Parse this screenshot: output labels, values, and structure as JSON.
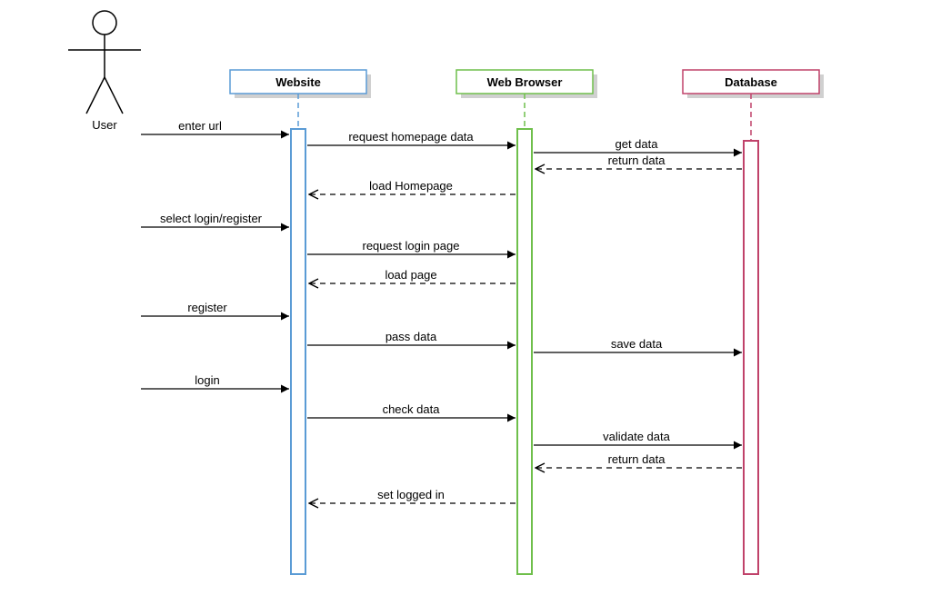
{
  "actor": {
    "name": "User"
  },
  "participants": [
    {
      "id": "website",
      "label": "Website",
      "color": "#5A9BD5"
    },
    {
      "id": "browser",
      "label": "Web Browser",
      "color": "#6FBF4B"
    },
    {
      "id": "database",
      "label": "Database",
      "color": "#C0426A"
    }
  ],
  "messages": [
    {
      "id": "m1",
      "from": "user",
      "to": "website",
      "text": "enter url",
      "style": "solid"
    },
    {
      "id": "m2",
      "from": "website",
      "to": "browser",
      "text": "request homepage data",
      "style": "solid"
    },
    {
      "id": "m3",
      "from": "browser",
      "to": "database",
      "text": "get data",
      "style": "solid"
    },
    {
      "id": "m4",
      "from": "database",
      "to": "browser",
      "text": "return data",
      "style": "dashed"
    },
    {
      "id": "m5",
      "from": "browser",
      "to": "website",
      "text": "load Homepage",
      "style": "dashed"
    },
    {
      "id": "m6",
      "from": "user",
      "to": "website",
      "text": "select login/register",
      "style": "solid"
    },
    {
      "id": "m7",
      "from": "website",
      "to": "browser",
      "text": "request login page",
      "style": "solid"
    },
    {
      "id": "m8",
      "from": "browser",
      "to": "website",
      "text": "load page",
      "style": "dashed"
    },
    {
      "id": "m9",
      "from": "user",
      "to": "website",
      "text": "register",
      "style": "solid"
    },
    {
      "id": "m10",
      "from": "website",
      "to": "browser",
      "text": "pass data",
      "style": "solid"
    },
    {
      "id": "m11",
      "from": "browser",
      "to": "database",
      "text": "save data",
      "style": "solid"
    },
    {
      "id": "m12",
      "from": "user",
      "to": "website",
      "text": "login",
      "style": "solid"
    },
    {
      "id": "m13",
      "from": "website",
      "to": "browser",
      "text": "check data",
      "style": "solid"
    },
    {
      "id": "m14",
      "from": "browser",
      "to": "database",
      "text": "validate data",
      "style": "solid"
    },
    {
      "id": "m15",
      "from": "database",
      "to": "browser",
      "text": "return data",
      "style": "dashed"
    },
    {
      "id": "m16",
      "from": "browser",
      "to": "website",
      "text": "set logged in",
      "style": "dashed"
    }
  ],
  "chart_data": {
    "type": "sequence-diagram",
    "title": "",
    "actor": "User",
    "participants": [
      "Website",
      "Web Browser",
      "Database"
    ],
    "messages": [
      {
        "from": "User",
        "to": "Website",
        "label": "enter url",
        "return": false
      },
      {
        "from": "Website",
        "to": "Web Browser",
        "label": "request homepage data",
        "return": false
      },
      {
        "from": "Web Browser",
        "to": "Database",
        "label": "get data",
        "return": false
      },
      {
        "from": "Database",
        "to": "Web Browser",
        "label": "return data",
        "return": true
      },
      {
        "from": "Web Browser",
        "to": "Website",
        "label": "load Homepage",
        "return": true
      },
      {
        "from": "User",
        "to": "Website",
        "label": "select login/register",
        "return": false
      },
      {
        "from": "Website",
        "to": "Web Browser",
        "label": "request login page",
        "return": false
      },
      {
        "from": "Web Browser",
        "to": "Website",
        "label": "load page",
        "return": true
      },
      {
        "from": "User",
        "to": "Website",
        "label": "register",
        "return": false
      },
      {
        "from": "Website",
        "to": "Web Browser",
        "label": "pass data",
        "return": false
      },
      {
        "from": "Web Browser",
        "to": "Database",
        "label": "save data",
        "return": false
      },
      {
        "from": "User",
        "to": "Website",
        "label": "login",
        "return": false
      },
      {
        "from": "Website",
        "to": "Web Browser",
        "label": "check data",
        "return": false
      },
      {
        "from": "Web Browser",
        "to": "Database",
        "label": "validate data",
        "return": false
      },
      {
        "from": "Database",
        "to": "Web Browser",
        "label": "return data",
        "return": true
      },
      {
        "from": "Web Browser",
        "to": "Website",
        "label": "set logged in",
        "return": true
      }
    ]
  }
}
